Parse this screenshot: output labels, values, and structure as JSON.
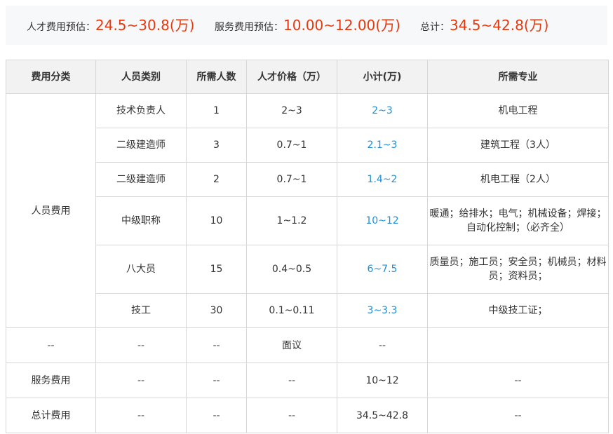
{
  "summary": {
    "talent_label": "人才费用预估：",
    "talent_value": "24.5~30.8(万)",
    "service_label": "服务费用预估：",
    "service_value": "10.00~12.00(万)",
    "total_label": "总计：",
    "total_value": "34.5~42.8(万)"
  },
  "table": {
    "headers": [
      "费用分类",
      "人员类别",
      "所需人数",
      "人才价格（万）",
      "小计(万)",
      "所需专业"
    ],
    "category": "人员费用",
    "rows": [
      {
        "type": "技术负责人",
        "count": "1",
        "price": "2~3",
        "subtotal": "2~3",
        "major": "机电工程"
      },
      {
        "type": "二级建造师",
        "count": "3",
        "price": "0.7~1",
        "subtotal": "2.1~3",
        "major": "建筑工程（3人）"
      },
      {
        "type": "二级建造师",
        "count": "2",
        "price": "0.7~1",
        "subtotal": "1.4~2",
        "major": "机电工程（2人）"
      },
      {
        "type": "中级职称",
        "count": "10",
        "price": "1~1.2",
        "subtotal": "10~12",
        "major": "暖通；给排水；电气；机械设备；焊接；自动化控制；（必齐全）"
      },
      {
        "type": "八大员",
        "count": "15",
        "price": "0.4~0.5",
        "subtotal": "6~7.5",
        "major": "质量员；施工员；安全员；机械员；材料员；资料员；"
      },
      {
        "type": "技工",
        "count": "30",
        "price": "0.1~0.11",
        "subtotal": "3~3.3",
        "major": "中级技工证；"
      }
    ],
    "negotiable_row": {
      "category": "--",
      "type": "--",
      "count": "--",
      "price": "面议",
      "subtotal": "--",
      "major": ""
    },
    "service_row": {
      "category": "服务费用",
      "type": "--",
      "count": "--",
      "price": "--",
      "subtotal": "10~12",
      "major": "--"
    },
    "total_row": {
      "category": "总计费用",
      "type": "--",
      "count": "--",
      "price": "--",
      "subtotal": "34.5~42.8",
      "major": "--"
    }
  },
  "colors": {
    "highlight_red": "#e8380d",
    "subtotal_blue": "#1f8fd6",
    "header_bg": "#f2f2f2",
    "summary_bg": "#f7f8fa"
  }
}
